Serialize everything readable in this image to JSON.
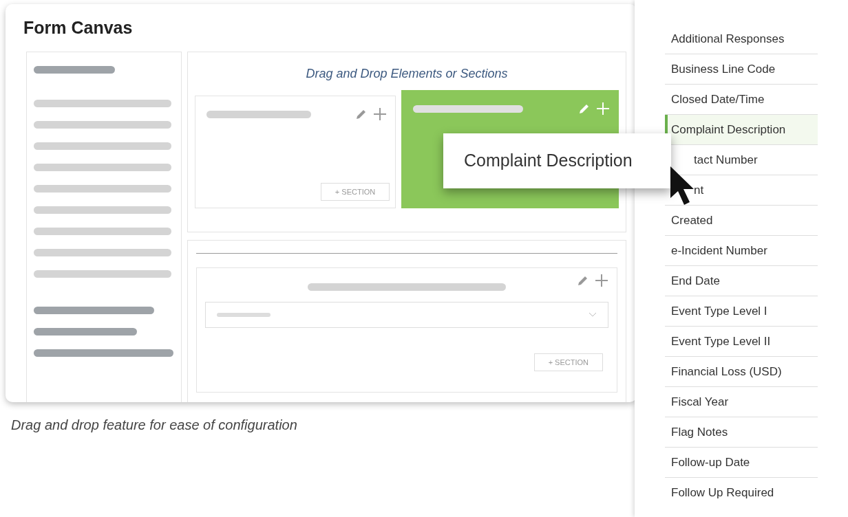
{
  "canvas": {
    "title": "Form Canvas",
    "drop_hint": "Drag and Drop Elements or Sections",
    "top_sections": [
      {
        "selected": false,
        "button": "+ SECTION"
      },
      {
        "selected": true
      }
    ],
    "lower_section": {
      "button": "+ SECTION"
    }
  },
  "caption": "Drag and drop feature for ease of configuration",
  "field_list": [
    {
      "label": "Additional Responses",
      "kind": "plain",
      "selected": false
    },
    {
      "label": "Business Line Code",
      "kind": "plain",
      "selected": false
    },
    {
      "label": "Closed Date/Time",
      "kind": "plain",
      "selected": false
    },
    {
      "label": "Complaint Description",
      "kind": "plain",
      "selected": true
    },
    {
      "label": "tact Number",
      "kind": "covered",
      "selected": false
    },
    {
      "label": "nt",
      "kind": "covered",
      "selected": false
    },
    {
      "label": "Created",
      "kind": "plain",
      "selected": false
    },
    {
      "label": "e-Incident Number",
      "kind": "plain",
      "selected": false
    },
    {
      "label": "End Date",
      "kind": "plain",
      "selected": false
    },
    {
      "label": "Event Type Level I",
      "kind": "plain",
      "selected": false
    },
    {
      "label": "Event Type Level II",
      "kind": "plain",
      "selected": false
    },
    {
      "label": "Financial Loss (USD)",
      "kind": "plain",
      "selected": false
    },
    {
      "label": "Fiscal Year",
      "kind": "plain",
      "selected": false
    },
    {
      "label": "Flag Notes",
      "kind": "plain",
      "selected": false
    },
    {
      "label": "Follow-up Date",
      "kind": "plain",
      "selected": false
    },
    {
      "label": "Follow Up Required",
      "kind": "plain",
      "selected": false
    }
  ],
  "drag_tooltip": "Complaint Description"
}
